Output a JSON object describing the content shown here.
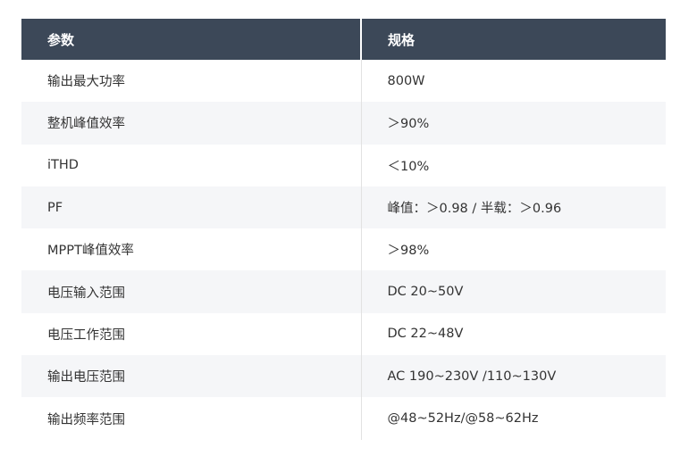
{
  "table": {
    "headers": [
      "参数",
      "规格"
    ],
    "rows": [
      {
        "param": "输出最大功率",
        "spec": "800W"
      },
      {
        "param": "整机峰值效率",
        "spec": "＞90%"
      },
      {
        "param": "iTHD",
        "spec": "＜10%"
      },
      {
        "param": "PF",
        "spec": "峰值：＞0.98 / 半载：＞0.96"
      },
      {
        "param": "MPPT峰值效率",
        "spec": "＞98%"
      },
      {
        "param": "电压输入范围",
        "spec": "DC 20~50V"
      },
      {
        "param": "电压工作范围",
        "spec": "DC 22~48V"
      },
      {
        "param": "输出电压范围",
        "spec": "AC 190~230V /110~130V"
      },
      {
        "param": "输出频率范围",
        "spec": "@48~52Hz/@58~62Hz"
      }
    ]
  }
}
